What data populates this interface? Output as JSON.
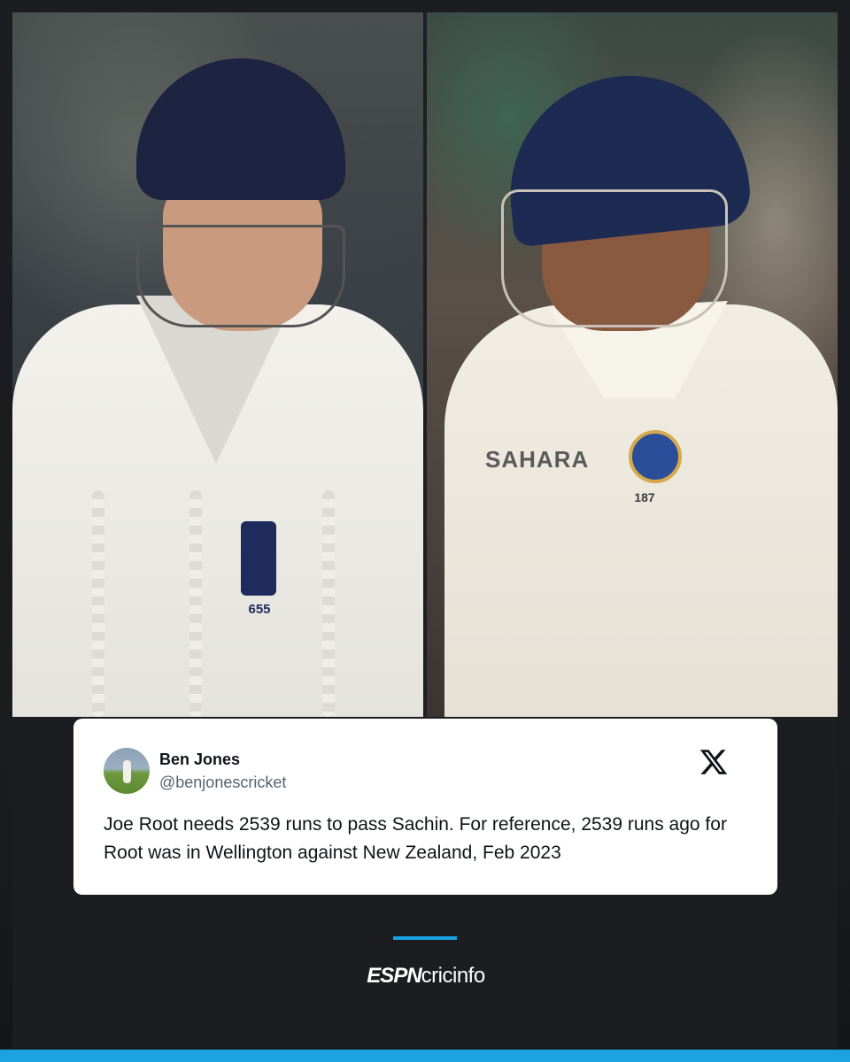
{
  "tweet": {
    "author_name": "Ben Jones",
    "author_handle": "@benjonescricket",
    "text": "Joe Root needs 2539 runs to pass Sachin. For reference, 2539 runs ago for Root was in Wellington against New Zealand, Feb 2023",
    "platform_icon": "x-logo-icon"
  },
  "photos": {
    "left": {
      "shirt_number": "655"
    },
    "right": {
      "shirt_number": "187",
      "sponsor_text": "SAHARA"
    }
  },
  "branding": {
    "logo_part1": "ESPN",
    "logo_part2": "cricinfo"
  },
  "colors": {
    "accent": "#1aa3e0",
    "background": "#1b1d21",
    "card": "#ffffff"
  }
}
